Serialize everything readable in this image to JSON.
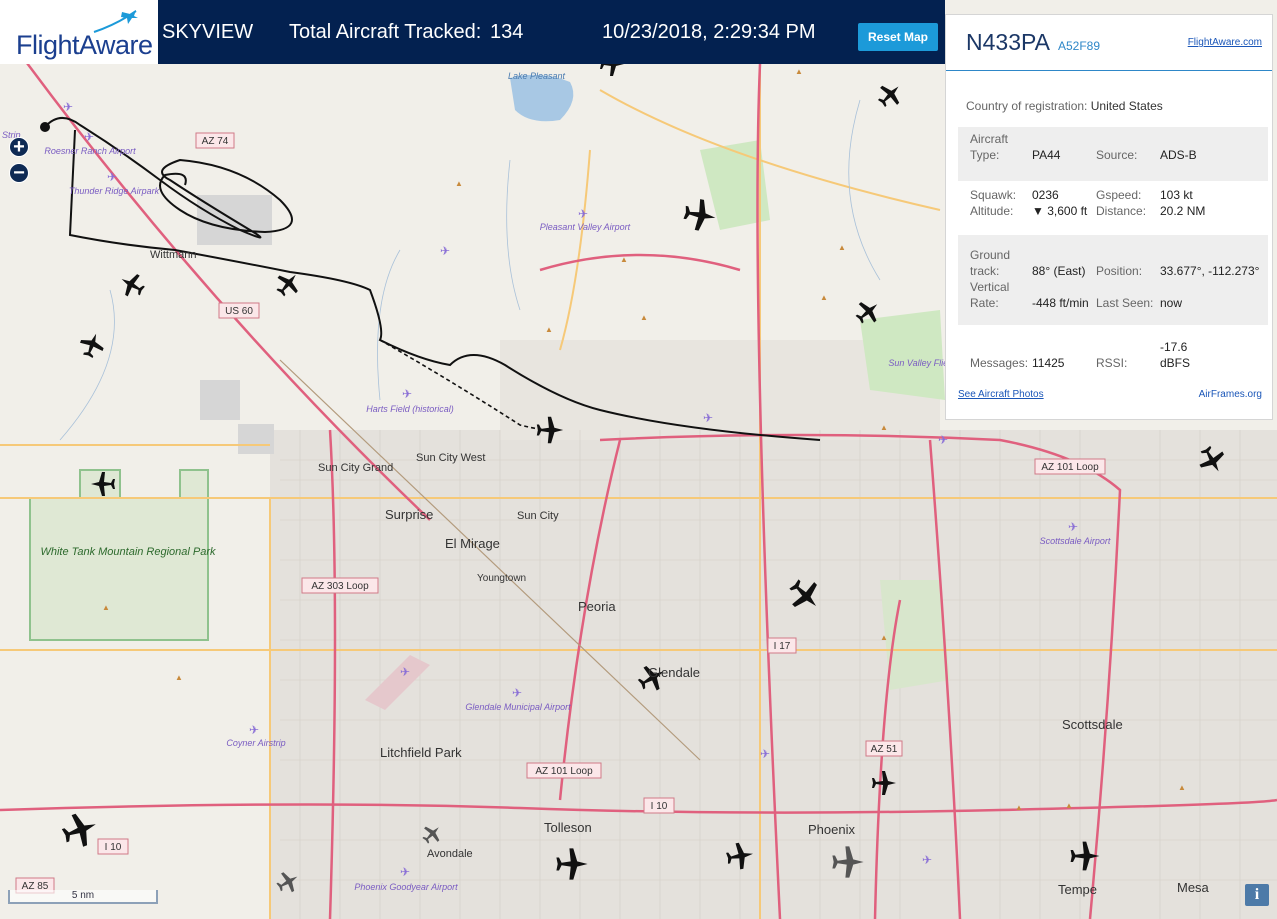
{
  "header": {
    "logo": "FlightAware",
    "title": "SKYVIEW",
    "total_label": "Total Aircraft Tracked:",
    "total_value": "134",
    "datetime": "10/23/2018, 2:29:34 PM",
    "reset_label": "Reset Map"
  },
  "map": {
    "zoom_in": "+",
    "zoom_out": "−",
    "scale": "5 nm",
    "info": "i",
    "places": [
      {
        "name": "Surprise"
      },
      {
        "name": "El Mirage"
      },
      {
        "name": "Peoria"
      },
      {
        "name": "Glendale"
      },
      {
        "name": "Sun City Grand"
      },
      {
        "name": "Sun City West"
      },
      {
        "name": "Sun City"
      },
      {
        "name": "Youngtown"
      },
      {
        "name": "Litchfield Park"
      },
      {
        "name": "Tolleson"
      },
      {
        "name": "Avondale"
      },
      {
        "name": "Phoenix"
      },
      {
        "name": "Scottsdale"
      },
      {
        "name": "Tempe"
      },
      {
        "name": "Mesa"
      },
      {
        "name": "Wittmann"
      }
    ],
    "airports": [
      "Roesner Ranch Airport",
      "Thunder Ridge Airpark",
      "Pleasant Valley Airport",
      "Harts Field (historical)",
      "Glendale Municipal Airport",
      "Coyner Airstrip",
      "Phoenix Goodyear Airport",
      "Scottsdale Airport",
      "Sun Valley Fliers"
    ],
    "features": [
      "Lake Pleasant",
      "White Tank Mountain Regional Park",
      "Strip"
    ],
    "road_badges": [
      "AZ 74",
      "US 60",
      "AZ 303 Loop",
      "AZ 101 Loop",
      "AZ 101 Loop",
      "I 17",
      "AZ 51",
      "I 10",
      "I 10",
      "AZ 85"
    ]
  },
  "aircraft": {
    "tail": "N433PA",
    "hex": "A52F89",
    "link": "FlightAware.com",
    "country_label": "Country of registration:",
    "country": "United States",
    "type_label": "Aircraft Type:",
    "type": "PA44",
    "source_label": "Source:",
    "source": "ADS-B",
    "squawk_label": "Squawk:",
    "squawk": "0236",
    "gspeed_label": "Gspeed:",
    "gspeed": "103 kt",
    "altitude_label": "Altitude:",
    "altitude": "▼ 3,600 ft",
    "distance_label": "Distance:",
    "distance": "20.2 NM",
    "track_label": "Ground track:",
    "track": "88° (East)",
    "position_label": "Position:",
    "position": "33.677°, -112.273°",
    "vrate_label": "Vertical Rate:",
    "vrate": "-448 ft/min",
    "lastseen_label": "Last Seen:",
    "lastseen": "now",
    "messages_label": "Messages:",
    "messages": "11425",
    "rssi_label": "RSSI:",
    "rssi": "-17.6 dBFS",
    "photos_link": "See Aircraft Photos",
    "airframes_link": "AirFrames.org"
  },
  "colors": {
    "header_bg": "#032150",
    "accent": "#1c9ad9",
    "highway": "#e0607e",
    "arterial": "#f6c978",
    "park_border": "#8fc28d"
  }
}
